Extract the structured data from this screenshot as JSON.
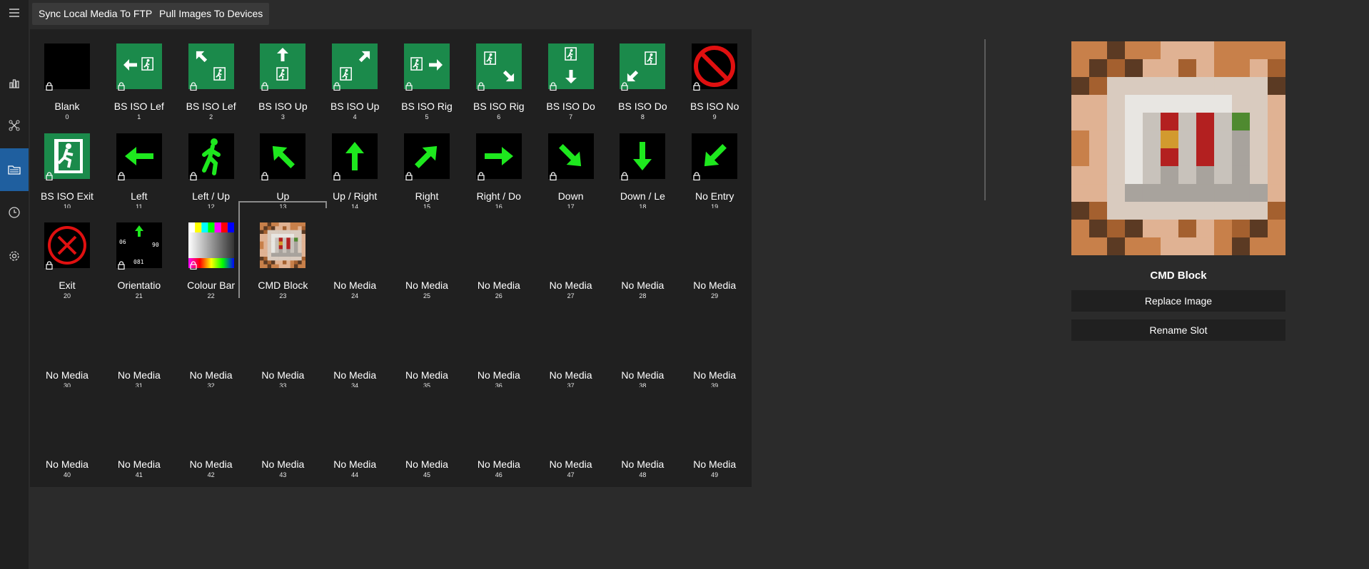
{
  "toolbar": {
    "sync_label": "Sync Local Media To FTP",
    "pull_label": "Pull Images To Devices"
  },
  "rail": {
    "items": [
      {
        "icon": "menu-icon"
      },
      {
        "icon": "stats-icon"
      },
      {
        "icon": "network-icon"
      },
      {
        "icon": "media-icon",
        "active": true
      },
      {
        "icon": "clock-icon"
      },
      {
        "icon": "settings-icon"
      }
    ]
  },
  "tiles": [
    {
      "index": "0",
      "name": "Blank",
      "thumb": "blank",
      "locked": true
    },
    {
      "index": "1",
      "name": "BS ISO Lef",
      "thumb": "iso-left",
      "locked": true
    },
    {
      "index": "2",
      "name": "BS ISO Lef",
      "thumb": "iso-upleft",
      "locked": true
    },
    {
      "index": "3",
      "name": "BS ISO Up",
      "thumb": "iso-up",
      "locked": true
    },
    {
      "index": "4",
      "name": "BS ISO Up",
      "thumb": "iso-upright",
      "locked": true
    },
    {
      "index": "5",
      "name": "BS ISO Rig",
      "thumb": "iso-right",
      "locked": true
    },
    {
      "index": "6",
      "name": "BS ISO Rig",
      "thumb": "iso-downright",
      "locked": true
    },
    {
      "index": "7",
      "name": "BS ISO Do",
      "thumb": "iso-down",
      "locked": true
    },
    {
      "index": "8",
      "name": "BS ISO Do",
      "thumb": "iso-downleft",
      "locked": true
    },
    {
      "index": "9",
      "name": "BS ISO No",
      "thumb": "no-sign",
      "locked": true
    },
    {
      "index": "10",
      "name": "BS ISO Exit",
      "thumb": "iso-exit",
      "locked": true
    },
    {
      "index": "11",
      "name": "Left",
      "thumb": "arrow-left",
      "locked": true
    },
    {
      "index": "12",
      "name": "Left / Up",
      "thumb": "walker",
      "locked": true
    },
    {
      "index": "13",
      "name": "Up",
      "thumb": "arrow-upleft",
      "locked": true
    },
    {
      "index": "14",
      "name": "Up / Right",
      "thumb": "arrow-up",
      "locked": true
    },
    {
      "index": "15",
      "name": "Right",
      "thumb": "arrow-upright",
      "locked": true
    },
    {
      "index": "16",
      "name": "Right / Do",
      "thumb": "arrow-right",
      "locked": true
    },
    {
      "index": "17",
      "name": "Down",
      "thumb": "arrow-downright",
      "locked": true
    },
    {
      "index": "18",
      "name": "Down / Le",
      "thumb": "arrow-down",
      "locked": true
    },
    {
      "index": "19",
      "name": "No Entry",
      "thumb": "arrow-downleft",
      "locked": true
    },
    {
      "index": "20",
      "name": "Exit",
      "thumb": "exit-x",
      "locked": true
    },
    {
      "index": "21",
      "name": "Orientatio",
      "thumb": "orientation",
      "locked": true
    },
    {
      "index": "22",
      "name": "Colour Bar",
      "thumb": "colour-bars",
      "locked": true
    },
    {
      "index": "23",
      "name": "CMD Block",
      "thumb": "cmd-block",
      "locked": false,
      "selected": true
    },
    {
      "index": "24",
      "name": "No Media"
    },
    {
      "index": "25",
      "name": "No Media"
    },
    {
      "index": "26",
      "name": "No Media"
    },
    {
      "index": "27",
      "name": "No Media"
    },
    {
      "index": "28",
      "name": "No Media"
    },
    {
      "index": "29",
      "name": "No Media"
    },
    {
      "index": "30",
      "name": "No Media"
    },
    {
      "index": "31",
      "name": "No Media"
    },
    {
      "index": "32",
      "name": "No Media"
    },
    {
      "index": "33",
      "name": "No Media"
    },
    {
      "index": "34",
      "name": "No Media"
    },
    {
      "index": "35",
      "name": "No Media"
    },
    {
      "index": "36",
      "name": "No Media"
    },
    {
      "index": "37",
      "name": "No Media"
    },
    {
      "index": "38",
      "name": "No Media"
    },
    {
      "index": "39",
      "name": "No Media"
    },
    {
      "index": "40",
      "name": "No Media"
    },
    {
      "index": "41",
      "name": "No Media"
    },
    {
      "index": "42",
      "name": "No Media"
    },
    {
      "index": "43",
      "name": "No Media"
    },
    {
      "index": "44",
      "name": "No Media"
    },
    {
      "index": "45",
      "name": "No Media"
    },
    {
      "index": "46",
      "name": "No Media"
    },
    {
      "index": "47",
      "name": "No Media"
    },
    {
      "index": "48",
      "name": "No Media"
    },
    {
      "index": "49",
      "name": "No Media"
    }
  ],
  "preview": {
    "title": "CMD Block",
    "replace_label": "Replace Image",
    "rename_label": "Rename Slot"
  },
  "colors": {
    "iso_green": "#1b8a4b",
    "bright_green": "#1ee81e",
    "no_red": "#e01010",
    "accent": "#1f5f9f"
  }
}
